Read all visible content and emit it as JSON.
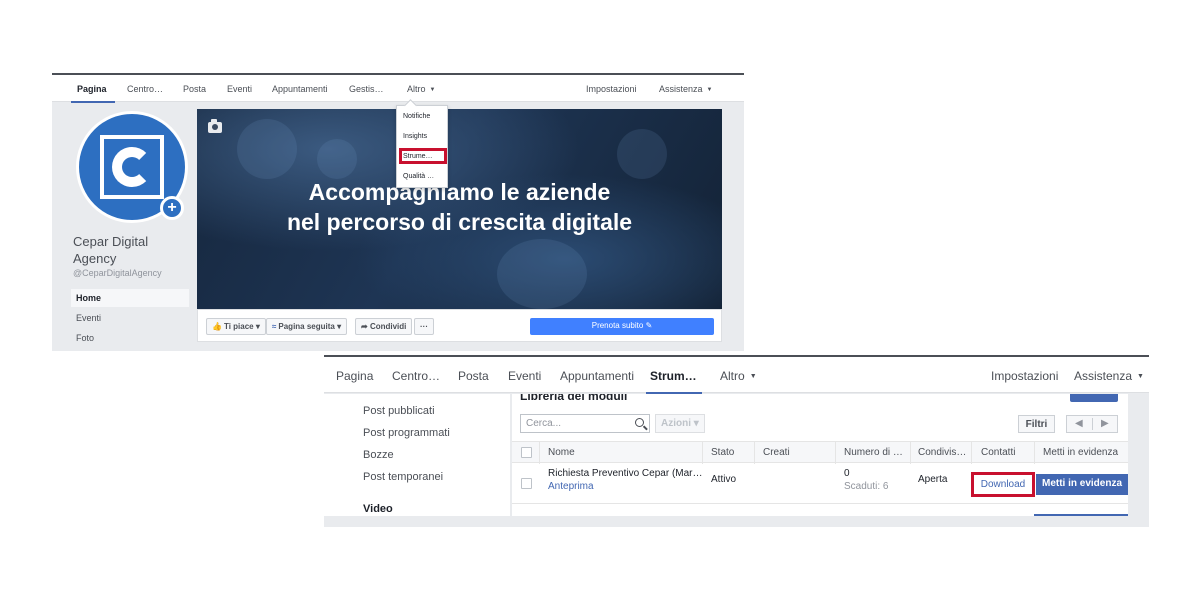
{
  "top_screenshot": {
    "nav": {
      "tabs": [
        "Pagina",
        "Centro…",
        "Posta",
        "Eventi",
        "Appuntamenti",
        "Gestis…",
        "Altro"
      ],
      "right": [
        "Impostazioni",
        "Assistenza"
      ]
    },
    "dropdown": {
      "items": [
        "Notifiche",
        "Insights",
        "Strume…",
        "Qualità …"
      ],
      "highlighted": "Strume…"
    },
    "profile": {
      "logo_letter": "C",
      "name": "Cepar Digital Agency",
      "handle": "@CeparDigitalAgency"
    },
    "sidenav": [
      "Home",
      "Eventi",
      "Foto"
    ],
    "cover": {
      "headline_line1": "Accompagniamo le aziende",
      "headline_line2": "nel percorso di crescita digitale"
    },
    "actions": {
      "like": "Ti piace",
      "follow": "Pagina seguita",
      "share": "Condividi",
      "more": "···",
      "cta": "Prenota subito"
    }
  },
  "bottom_screenshot": {
    "nav": {
      "tabs": [
        "Pagina",
        "Centro…",
        "Posta",
        "Eventi",
        "Appuntamenti",
        "Strum…",
        "Altro"
      ],
      "active_tab": "Strum…",
      "right": [
        "Impostazioni",
        "Assistenza"
      ]
    },
    "sidebar": [
      "Post pubblicati",
      "Post programmati",
      "Bozze",
      "Post temporanei",
      "Video"
    ],
    "library_title": "Libreria dei moduli",
    "search_placeholder": "Cerca...",
    "actions_label": "Azioni",
    "filters_label": "Filtri",
    "pager": {
      "prev": "◀",
      "next": "▶"
    },
    "columns": [
      "Nome",
      "Stato",
      "Creati",
      "Numero di …",
      "Condivis…",
      "Contatti",
      "Metti in evidenza"
    ],
    "rows": [
      {
        "name": "Richiesta Preventivo Cepar (Mar…",
        "preview": "Anteprima",
        "status": "Attivo",
        "count": "0",
        "expired": "Scaduti: 6",
        "sharing": "Aperta",
        "contacts": "Download",
        "feature": "Metti in evidenza"
      }
    ]
  },
  "colors": {
    "fb_blue": "#4267b2",
    "cta_blue": "#4080ff",
    "highlight_red": "#c8102e",
    "logo_blue": "#2d6fc1"
  }
}
